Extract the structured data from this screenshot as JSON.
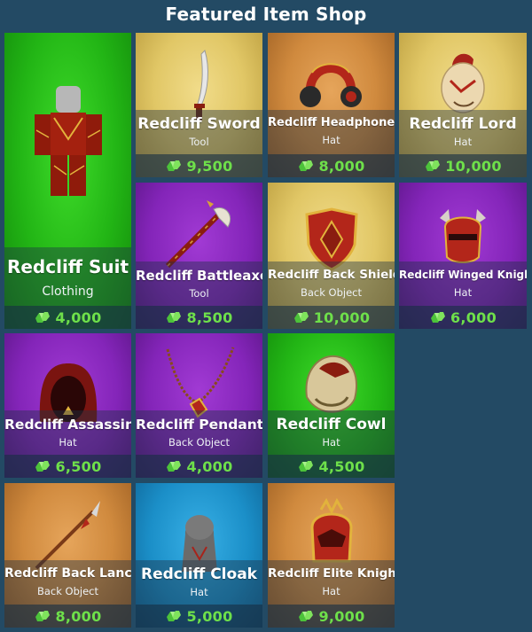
{
  "header": {
    "title": "Featured Item Shop"
  },
  "items": [
    {
      "name": "Redcliff Suit",
      "type": "Clothing",
      "price": "4,000"
    },
    {
      "name": "Redcliff Sword",
      "type": "Tool",
      "price": "9,500"
    },
    {
      "name": "Redcliff Headphones",
      "type": "Hat",
      "price": "8,000"
    },
    {
      "name": "Redcliff Lord",
      "type": "Hat",
      "price": "10,000"
    },
    {
      "name": "Redcliff Battleaxe",
      "type": "Tool",
      "price": "8,500"
    },
    {
      "name": "Redcliff Back Shield",
      "type": "Back Object",
      "price": "10,000"
    },
    {
      "name": "Redcliff Winged Knight",
      "type": "Hat",
      "price": "6,000"
    },
    {
      "name": "Redcliff Assassin",
      "type": "Hat",
      "price": "6,500"
    },
    {
      "name": "Redcliff Pendant",
      "type": "Back Object",
      "price": "4,000"
    },
    {
      "name": "Redcliff Cowl",
      "type": "Hat",
      "price": "4,500"
    },
    {
      "name": "Redcliff Back Lance",
      "type": "Back Object",
      "price": "8,000"
    },
    {
      "name": "Redcliff Cloak",
      "type": "Hat",
      "price": "5,000"
    },
    {
      "name": "Redcliff Elite Knight",
      "type": "Hat",
      "price": "9,000"
    }
  ],
  "icons": {
    "currency": "gems-icon",
    "suit": "redcliff-suit-icon",
    "sword": "sword-icon",
    "headphones": "headphones-icon",
    "helmet": "helmet-icon",
    "battleaxe": "battleaxe-icon",
    "shield": "shield-icon",
    "winged-helmet": "winged-helmet-icon",
    "hood": "hood-icon",
    "pendant": "pendant-icon",
    "cowl": "cowl-icon",
    "lance": "lance-icon",
    "cloak": "cloak-icon",
    "elite-helmet": "elite-helmet-icon"
  },
  "colors": {
    "background": "#234a64",
    "price_text": "#6ee04a",
    "card_green": "#22b515",
    "card_gold": "#e1c766",
    "card_orange": "#d08a3e",
    "card_purple": "#8425b9",
    "card_blue": "#1b8fc8"
  }
}
